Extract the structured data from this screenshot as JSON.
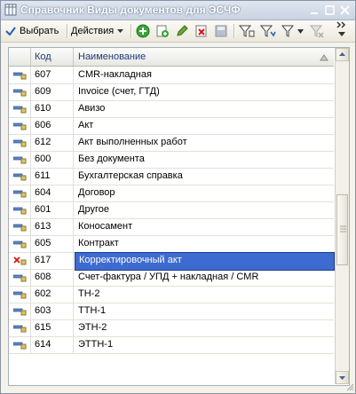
{
  "window": {
    "title": "Справочник Виды документов для ЭСЧФ"
  },
  "toolbar": {
    "select_label": "Выбрать",
    "actions_label": "Действия"
  },
  "grid": {
    "col_code": "Код",
    "col_name": "Наименование",
    "rows": [
      {
        "code": "607",
        "name": "CMR-накладная",
        "marked": false
      },
      {
        "code": "609",
        "name": "Invoice (счет, ГТД)",
        "marked": false
      },
      {
        "code": "610",
        "name": "Авизо",
        "marked": false
      },
      {
        "code": "606",
        "name": "Акт",
        "marked": false
      },
      {
        "code": "612",
        "name": "Акт выполненных работ",
        "marked": false
      },
      {
        "code": "600",
        "name": "Без документа",
        "marked": false
      },
      {
        "code": "611",
        "name": "Бухгалтерская справка",
        "marked": false
      },
      {
        "code": "604",
        "name": "Договор",
        "marked": false
      },
      {
        "code": "601",
        "name": "Другое",
        "marked": false
      },
      {
        "code": "613",
        "name": "Коносамент",
        "marked": false
      },
      {
        "code": "605",
        "name": "Контракт",
        "marked": false
      },
      {
        "code": "617",
        "name": "Корректировочный акт",
        "marked": true
      },
      {
        "code": "608",
        "name": "Счет-фактура / УПД + накладная / CMR",
        "marked": false
      },
      {
        "code": "602",
        "name": "ТН-2",
        "marked": false
      },
      {
        "code": "603",
        "name": "ТТН-1",
        "marked": false
      },
      {
        "code": "615",
        "name": "ЭТН-2",
        "marked": false
      },
      {
        "code": "614",
        "name": "ЭТТН-1",
        "marked": false
      }
    ]
  }
}
